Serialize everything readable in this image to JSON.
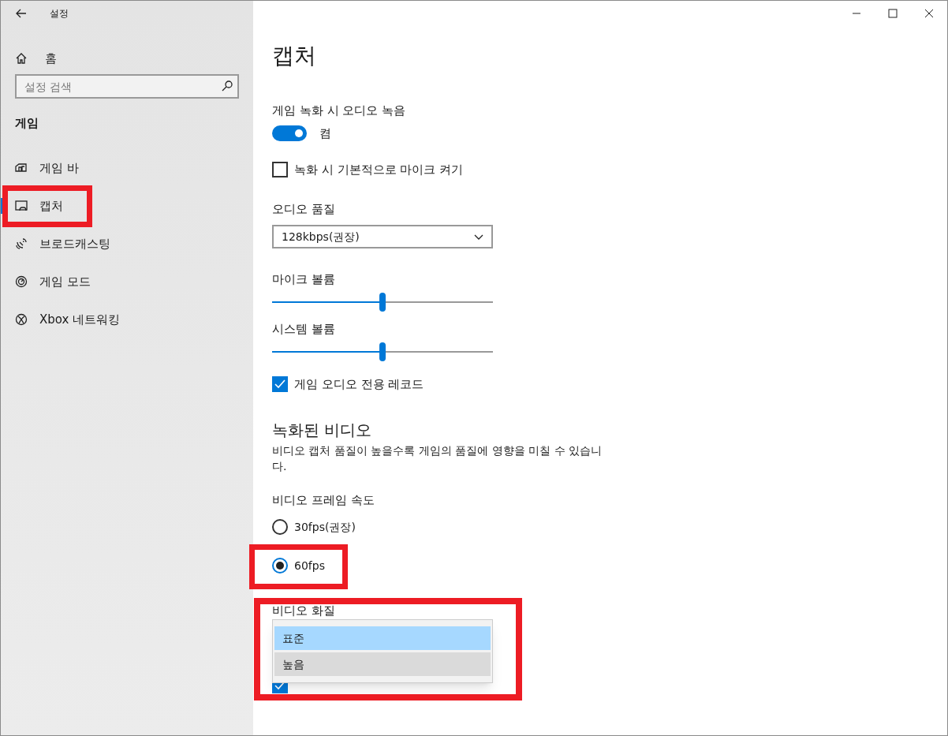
{
  "window": {
    "title": "설정"
  },
  "sidebar": {
    "home": "홈",
    "search": {
      "placeholder": "설정 검색"
    },
    "section": "게임",
    "items": [
      {
        "kind": "gamebar",
        "label": "게임 바",
        "selected": false,
        "highlighted": false
      },
      {
        "kind": "capture",
        "label": "캡처",
        "selected": true,
        "highlighted": true
      },
      {
        "kind": "broadcast",
        "label": "브로드캐스팅",
        "selected": false,
        "highlighted": false
      },
      {
        "kind": "gamemode",
        "label": "게임 모드",
        "selected": false,
        "highlighted": false
      },
      {
        "kind": "xbox",
        "label": "Xbox 네트워킹",
        "selected": false,
        "highlighted": false
      }
    ]
  },
  "page": {
    "title": "캡처",
    "settings": [
      {
        "kind": "label",
        "text": "게임 녹화 시 오디오 녹음"
      },
      {
        "kind": "toggle",
        "on": true,
        "text": "켬"
      },
      {
        "kind": "checkbox",
        "checked": false,
        "text": "녹화 시 기본적으로 마이크 켜기"
      },
      {
        "kind": "label",
        "text": "오디오 품질"
      },
      {
        "kind": "dropdown",
        "value": "128kbps(권장)"
      },
      {
        "kind": "label",
        "text": "마이크 볼륨"
      },
      {
        "kind": "slider",
        "level": 0.5
      },
      {
        "kind": "label",
        "text": "시스템 볼륨"
      },
      {
        "kind": "slider",
        "level": 0.5
      },
      {
        "kind": "checkbox",
        "checked": true,
        "text": "게임 오디오 전용 레코드"
      },
      {
        "kind": "heading",
        "text": "녹화된 비디오"
      },
      {
        "kind": "description",
        "text": "비디오 캡처 품질이 높을수록 게임의 품질에 영향을 미칠 수 있습니다."
      },
      {
        "kind": "label",
        "text": "비디오 프레임 속도"
      },
      {
        "kind": "radio",
        "selected": false,
        "text": "30fps(권장)",
        "highlighted": false
      },
      {
        "kind": "radio",
        "selected": true,
        "text": "60fps",
        "highlighted": true
      },
      {
        "kind": "quality",
        "label": "비디오 화질",
        "highlighted": true,
        "options": [
          {
            "text": "표준",
            "selected": true,
            "hovered": false
          },
          {
            "text": "높음",
            "selected": false,
            "hovered": true
          }
        ],
        "below": {
          "checked": true
        }
      }
    ]
  }
}
